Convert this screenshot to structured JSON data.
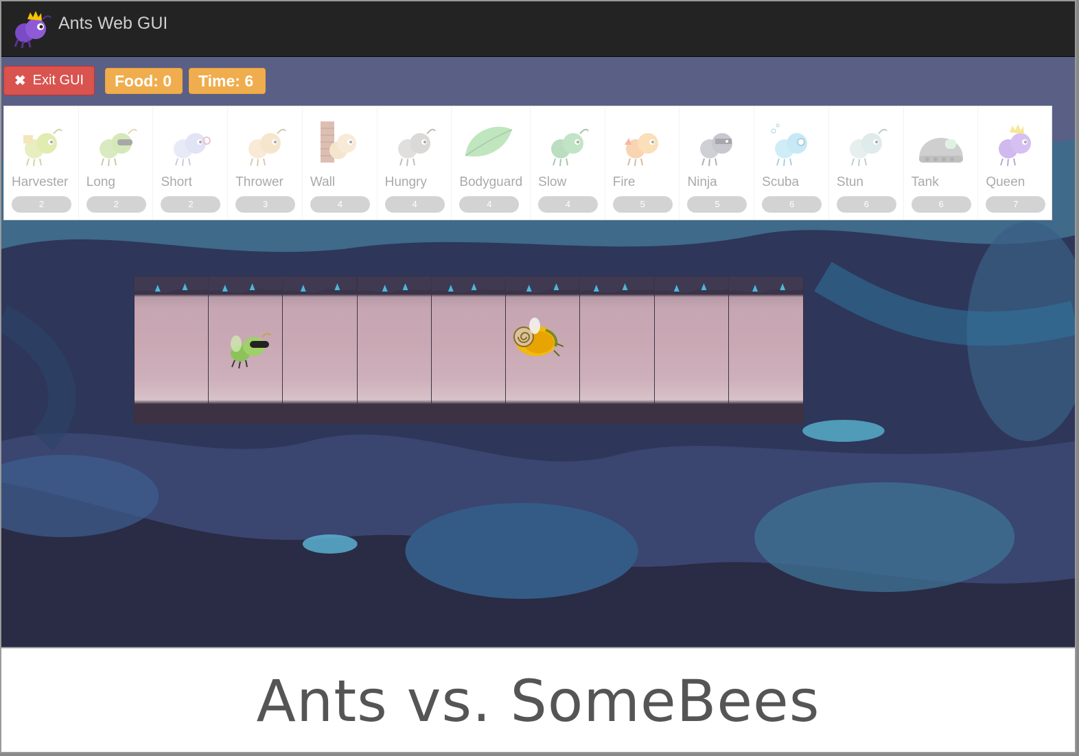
{
  "navbar": {
    "title": "Ants Web GUI"
  },
  "controls": {
    "exit_label": "Exit GUI",
    "food_label": "Food: 0",
    "time_label": "Time: 6"
  },
  "ant_types": [
    {
      "name": "Harvester",
      "cost": "2",
      "icon": "harvester-ant-icon"
    },
    {
      "name": "Long",
      "cost": "2",
      "icon": "long-thrower-ant-icon"
    },
    {
      "name": "Short",
      "cost": "2",
      "icon": "short-thrower-ant-icon"
    },
    {
      "name": "Thrower",
      "cost": "3",
      "icon": "thrower-ant-icon"
    },
    {
      "name": "Wall",
      "cost": "4",
      "icon": "wall-ant-icon"
    },
    {
      "name": "Hungry",
      "cost": "4",
      "icon": "hungry-ant-icon"
    },
    {
      "name": "Bodyguard",
      "cost": "4",
      "icon": "bodyguard-leaf-icon"
    },
    {
      "name": "Slow",
      "cost": "4",
      "icon": "slow-ant-icon"
    },
    {
      "name": "Fire",
      "cost": "5",
      "icon": "fire-ant-icon"
    },
    {
      "name": "Ninja",
      "cost": "5",
      "icon": "ninja-ant-icon"
    },
    {
      "name": "Scuba",
      "cost": "6",
      "icon": "scuba-ant-icon"
    },
    {
      "name": "Stun",
      "cost": "6",
      "icon": "stun-ant-icon"
    },
    {
      "name": "Tank",
      "cost": "6",
      "icon": "tank-ant-icon"
    },
    {
      "name": "Queen",
      "cost": "7",
      "icon": "queen-ant-icon"
    }
  ],
  "tunnel": {
    "place_count": 9,
    "occupants": [
      {
        "place": 1,
        "type": "long-thrower-ant"
      },
      {
        "place": 5,
        "type": "bee"
      }
    ]
  },
  "colors": {
    "exit_button": "#d9534f",
    "badge": "#f0ad4e",
    "navbar": "#232323"
  },
  "caption": {
    "text": "Ants vs. SomeBees"
  }
}
